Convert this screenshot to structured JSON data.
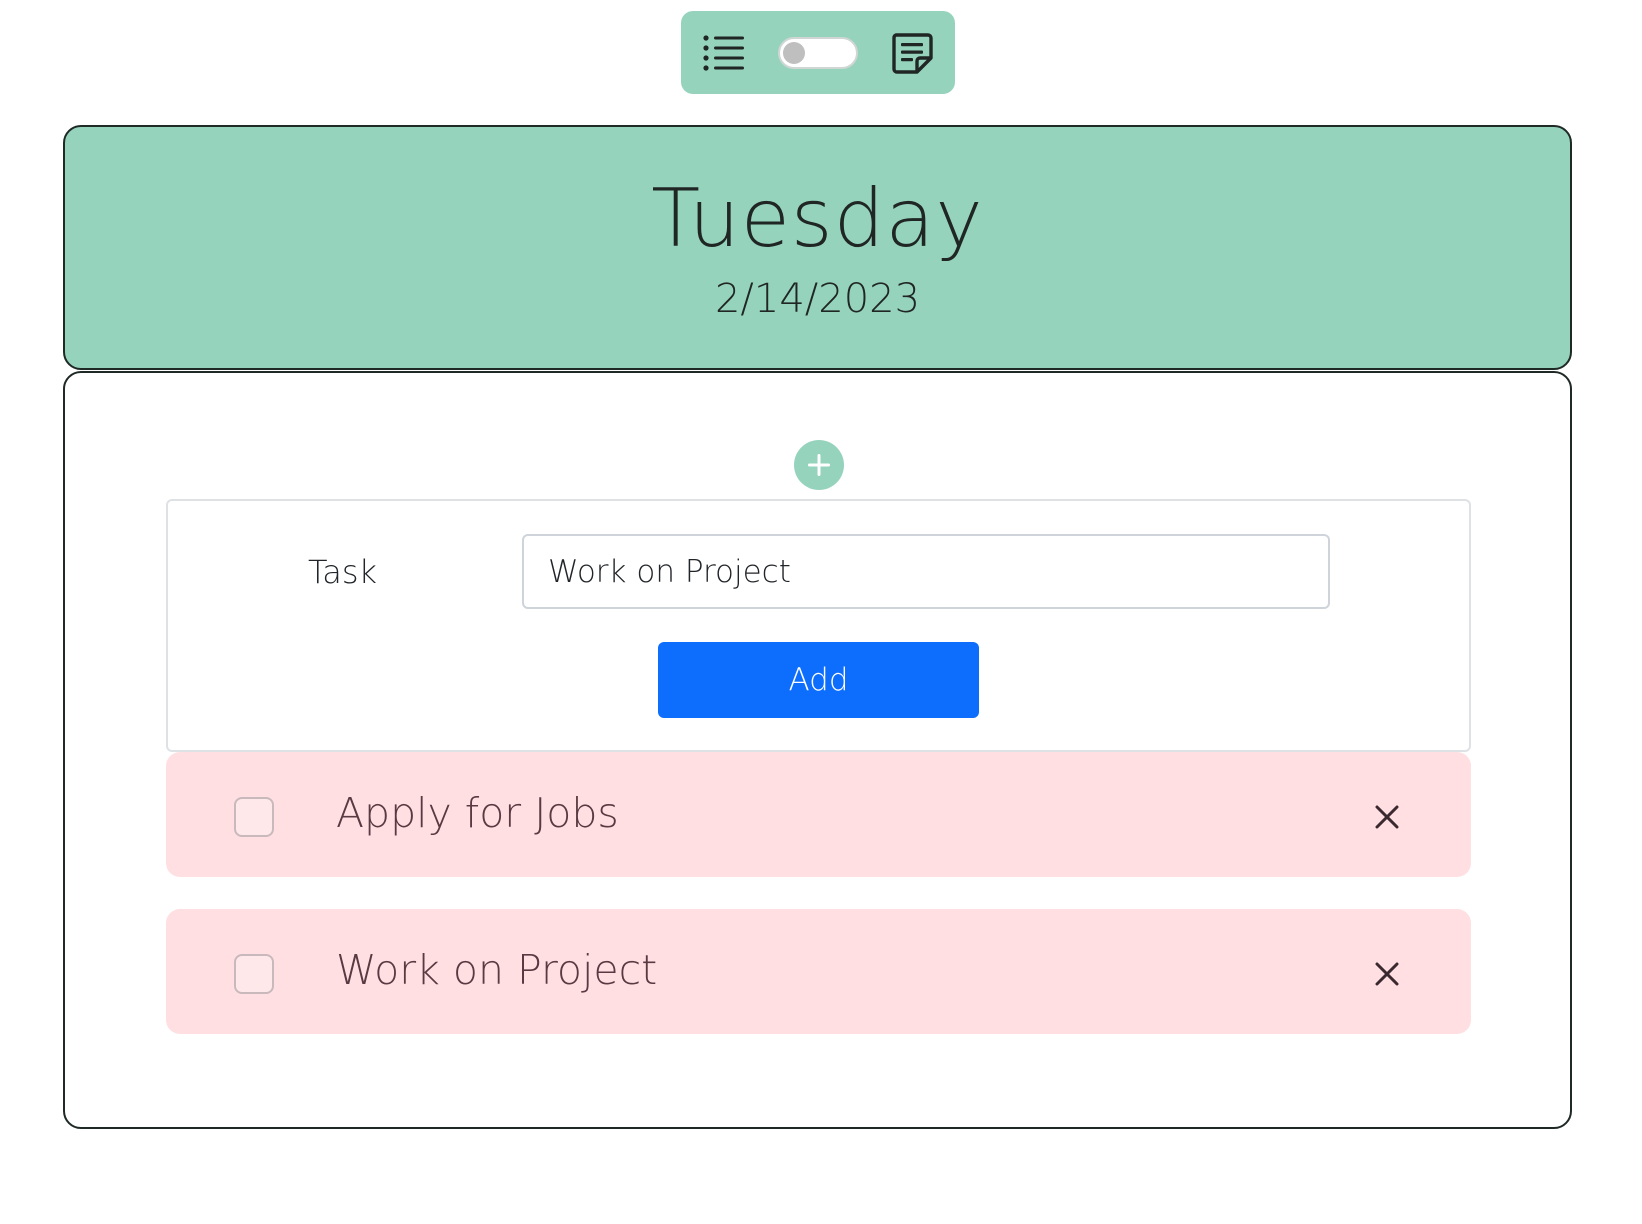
{
  "toolbar": {
    "list_icon": "list-icon",
    "toggle_state": "off",
    "notes_icon": "sticky-note-icon"
  },
  "header": {
    "day": "Tuesday",
    "date": "2/14/2023"
  },
  "form": {
    "add_icon": "plus-icon",
    "task_label": "Task",
    "task_value": "Work on Project",
    "add_button": "Add"
  },
  "tasks": [
    {
      "text": "Apply for Jobs",
      "checked": false
    },
    {
      "text": "Work on Project",
      "checked": false
    }
  ],
  "colors": {
    "accent": "#96d3bd",
    "primary_button": "#0d6efd",
    "task_background": "#ffdfe2"
  }
}
